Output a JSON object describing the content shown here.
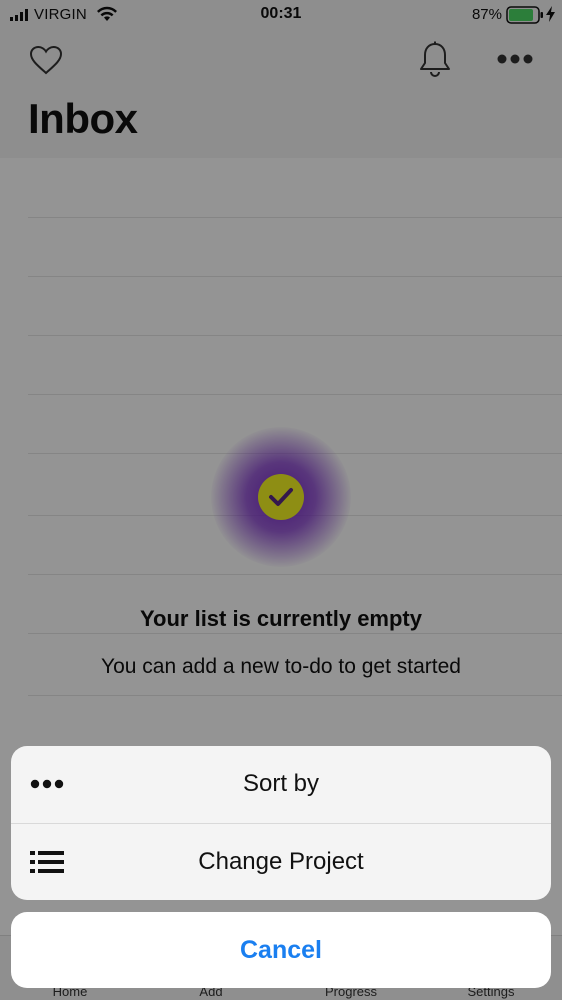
{
  "status_bar": {
    "carrier": "VIRGIN",
    "time": "00:31",
    "battery": "87%"
  },
  "header": {
    "title": "Inbox",
    "icons": [
      "heart-icon",
      "bell-icon",
      "more-icon"
    ]
  },
  "empty_state": {
    "title": "Your list is currently empty",
    "subtitle": "You can add a new to-do to get started",
    "icon": "checkmark-icon",
    "colors": {
      "glow": "#7828c8",
      "check_bg": "#f4f423",
      "check_mark": "#5b2a86"
    }
  },
  "tab_bar": {
    "tabs": [
      {
        "label": "Home"
      },
      {
        "label": "Add"
      },
      {
        "label": "Progress"
      },
      {
        "label": "Settings"
      }
    ]
  },
  "action_sheet": {
    "items": [
      {
        "label": "Sort by",
        "icon": "more-dots-icon"
      },
      {
        "label": "Change Project",
        "icon": "list-icon"
      }
    ],
    "cancel_label": "Cancel",
    "accent_color": "#1a7ff0"
  }
}
